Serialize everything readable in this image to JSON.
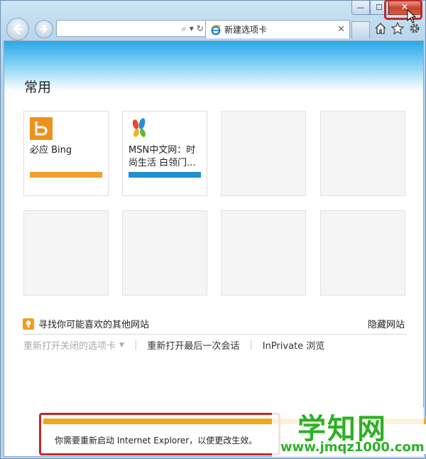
{
  "window": {
    "min_glyph": "—",
    "max_glyph": "☐",
    "close_glyph": "✕"
  },
  "nav": {
    "address_value": "",
    "search_glyph": "⌕",
    "dropdown_glyph": "▾",
    "refresh_glyph": "↻"
  },
  "tab": {
    "title": "新建选项卡",
    "close_glyph": "✕"
  },
  "new_tab_page": {
    "section_title": "常用",
    "tiles": [
      {
        "label": "必应 Bing",
        "bar_color": "#f0a030"
      },
      {
        "label": "MSN中文网：时尚生活 白领门...",
        "bar_color": "#1f8fd0"
      }
    ],
    "suggest_text": "寻找你可能喜欢的其他网站",
    "hide_sites": "隐藏网站",
    "links": {
      "reopen_closed_tabs": "重新打开关闭的选项卡",
      "separator": "|",
      "reopen_last_session": "重新打开最后一次会话",
      "inprivate": "InPrivate 浏览"
    }
  },
  "notification": {
    "text": "你需要重新启动 Internet Explorer，以使更改生效。"
  },
  "watermark": {
    "title": "学知网",
    "url": "www.jmqz1000.com"
  },
  "colors": {
    "accent_blue": "#29a8e8",
    "notify_orange": "#f0a818",
    "highlight_red": "#c0282a",
    "watermark_green": "#2db028"
  }
}
